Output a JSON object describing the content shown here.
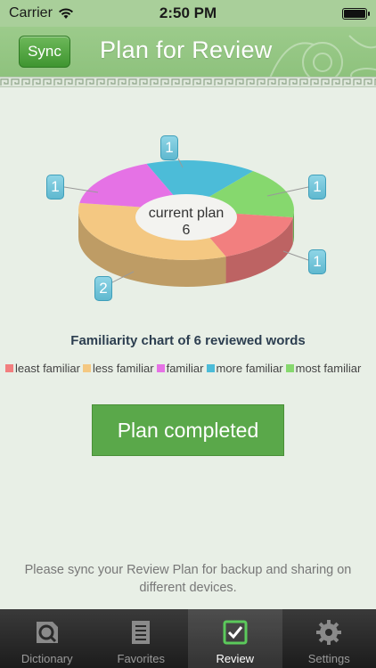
{
  "status": {
    "carrier": "Carrier",
    "time": "2:50 PM"
  },
  "nav": {
    "sync_label": "Sync",
    "title": "Plan for Review"
  },
  "chart_data": {
    "type": "pie",
    "title": "Familiarity chart of 6 reviewed words",
    "center_label": {
      "line1": "current plan",
      "line2": "6"
    },
    "slices": [
      {
        "name": "least familiar",
        "value": 1,
        "color": "#f27f7f"
      },
      {
        "name": "less familiar",
        "value": 2,
        "color": "#f4c882"
      },
      {
        "name": "familiar",
        "value": 1,
        "color": "#e572e5"
      },
      {
        "name": "more familiar",
        "value": 1,
        "color": "#4cbcd8"
      },
      {
        "name": "most familiar",
        "value": 1,
        "color": "#86d86e"
      }
    ],
    "callout_labels": [
      "1",
      "1",
      "1",
      "1",
      "2"
    ]
  },
  "legend": [
    {
      "label": "least familiar",
      "color": "#f27f7f"
    },
    {
      "label": "less familiar",
      "color": "#f4c882"
    },
    {
      "label": "familiar",
      "color": "#e572e5"
    },
    {
      "label": "more familiar",
      "color": "#4cbcd8"
    },
    {
      "label": "most familiar",
      "color": "#86d86e"
    }
  ],
  "actions": {
    "plan_button": "Plan completed"
  },
  "info_text": "Please sync your Review Plan for backup and sharing on different devices.",
  "tabs": [
    {
      "label": "Dictionary",
      "icon": "dictionary-icon",
      "active": false
    },
    {
      "label": "Favorites",
      "icon": "favorites-icon",
      "active": false
    },
    {
      "label": "Review",
      "icon": "review-icon",
      "active": true
    },
    {
      "label": "Settings",
      "icon": "settings-icon",
      "active": false
    }
  ]
}
